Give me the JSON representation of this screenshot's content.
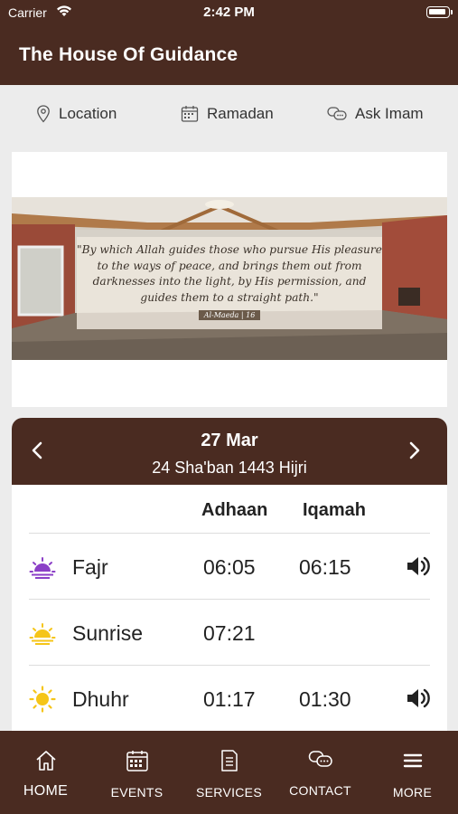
{
  "status_bar": {
    "carrier": "Carrier",
    "time": "2:42 PM"
  },
  "header": {
    "title": "The House Of Guidance"
  },
  "quick_links": [
    {
      "label": "Location",
      "icon": "map-pin-icon"
    },
    {
      "label": "Ramadan",
      "icon": "calendar-icon"
    },
    {
      "label": "Ask Imam",
      "icon": "chat-icon"
    }
  ],
  "banner": {
    "quote": "\"By which Allah guides those who pursue His pleasure to the ways of peace, and brings them out from darknesses into the light, by His permission, and guides them to a straight path.\"",
    "reference": "Al-Maeda | 16"
  },
  "prayer": {
    "date": "27 Mar",
    "hijri": "24 Sha'ban 1443 Hijri",
    "col_adhaan": "Adhaan",
    "col_iqamah": "Iqamah",
    "rows": [
      {
        "name": "Fajr",
        "adhaan": "06:05",
        "iqamah": "06:15",
        "icon": "fajr-sun-icon",
        "speaker": true
      },
      {
        "name": "Sunrise",
        "adhaan": "07:21",
        "iqamah": "",
        "icon": "sunrise-icon",
        "speaker": false
      },
      {
        "name": "Dhuhr",
        "adhaan": "01:17",
        "iqamah": "01:30",
        "icon": "sun-icon",
        "speaker": true
      }
    ]
  },
  "tabs": [
    {
      "label": "HOME",
      "icon": "home-icon",
      "active": true
    },
    {
      "label": "EVENTS",
      "icon": "calendar-icon"
    },
    {
      "label": "SERVICES",
      "icon": "document-icon"
    },
    {
      "label": "CONTACT",
      "icon": "chat-icon"
    },
    {
      "label": "MORE",
      "icon": "menu-icon"
    }
  ],
  "colors": {
    "brand": "#4a2b21",
    "fajr": "#8b3fc7",
    "sun": "#f5c518"
  }
}
